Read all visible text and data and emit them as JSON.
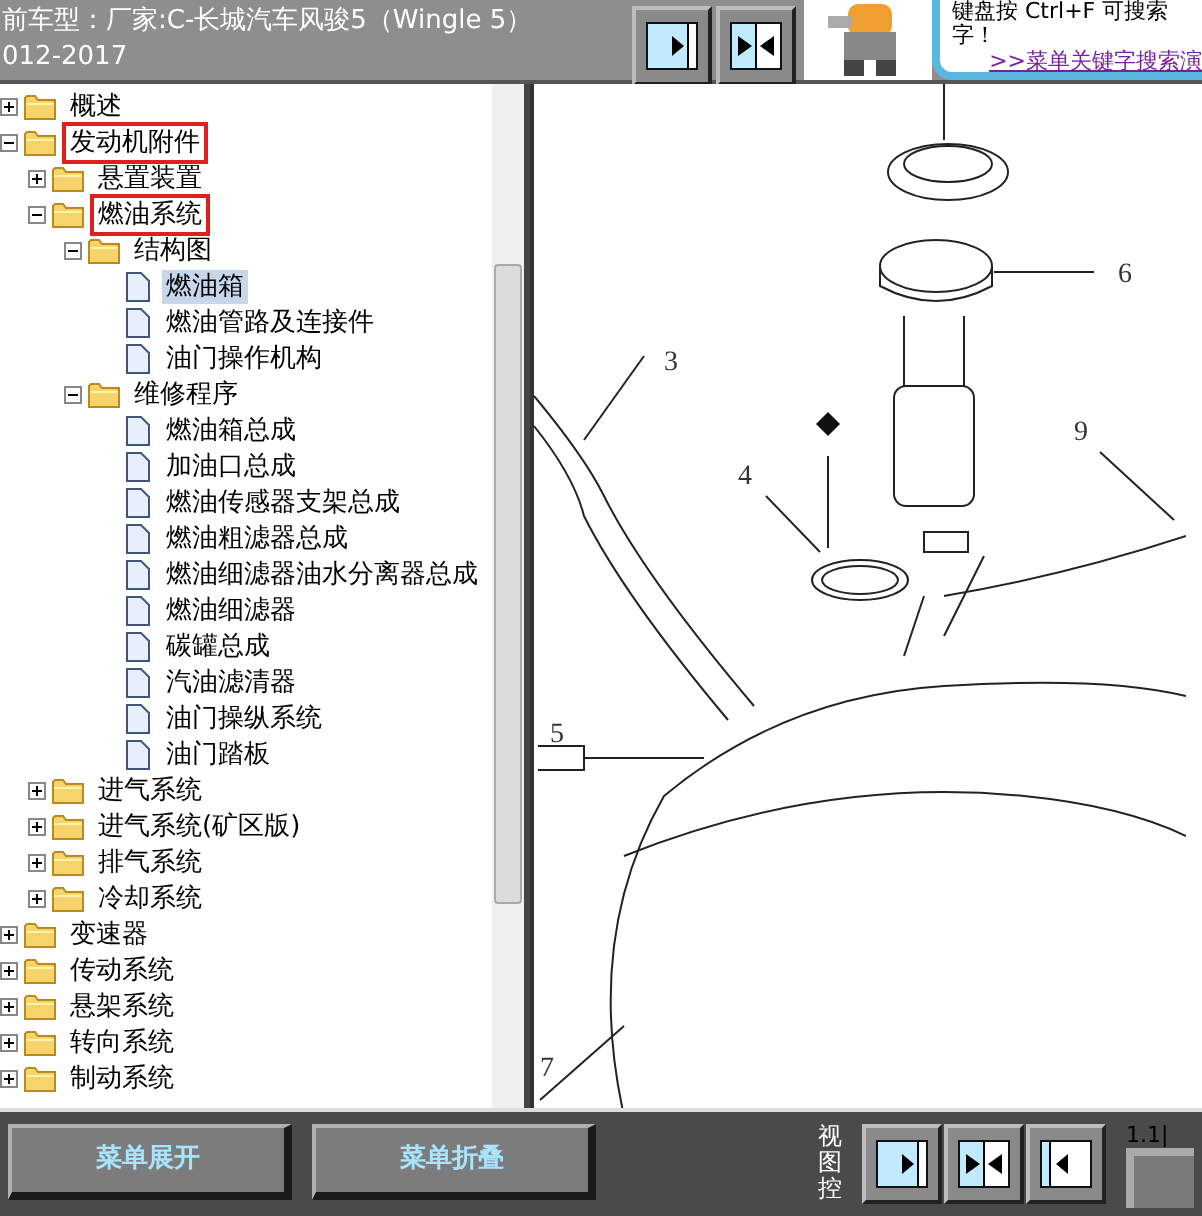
{
  "header": {
    "title_lines": [
      "前车型：厂家:C-长城汽车风骏5（Wingle 5）",
      "012-2017"
    ]
  },
  "tip": {
    "lines": [
      "键盘按 Ctrl+F 可搜索",
      "字！"
    ],
    "link": ">>菜单关键字搜索演"
  },
  "tree": [
    {
      "kind": "folder",
      "label": "概述",
      "expanded": false,
      "highlighted": false
    },
    {
      "kind": "folder",
      "label": "发动机附件",
      "expanded": true,
      "highlighted": true,
      "children": [
        {
          "kind": "folder",
          "label": "悬置装置",
          "expanded": false,
          "highlighted": false
        },
        {
          "kind": "folder",
          "label": "燃油系统",
          "expanded": true,
          "highlighted": true,
          "children": [
            {
              "kind": "folder",
              "label": "结构图",
              "expanded": true,
              "highlighted": false,
              "children": [
                {
                  "kind": "document",
                  "label": "燃油箱",
                  "selected": true
                },
                {
                  "kind": "document",
                  "label": "燃油管路及连接件",
                  "selected": false
                },
                {
                  "kind": "document",
                  "label": "油门操作机构",
                  "selected": false
                }
              ]
            },
            {
              "kind": "folder",
              "label": "维修程序",
              "expanded": true,
              "highlighted": false,
              "children": [
                {
                  "kind": "document",
                  "label": "燃油箱总成",
                  "selected": false
                },
                {
                  "kind": "document",
                  "label": "加油口总成",
                  "selected": false
                },
                {
                  "kind": "document",
                  "label": "燃油传感器支架总成",
                  "selected": false
                },
                {
                  "kind": "document",
                  "label": "燃油粗滤器总成",
                  "selected": false
                },
                {
                  "kind": "document",
                  "label": "燃油细滤器油水分离器总成",
                  "selected": false
                },
                {
                  "kind": "document",
                  "label": "燃油细滤器",
                  "selected": false
                },
                {
                  "kind": "document",
                  "label": "碳罐总成",
                  "selected": false
                },
                {
                  "kind": "document",
                  "label": "汽油滤清器",
                  "selected": false
                },
                {
                  "kind": "document",
                  "label": "油门操纵系统",
                  "selected": false
                },
                {
                  "kind": "document",
                  "label": "油门踏板",
                  "selected": false
                }
              ]
            }
          ]
        },
        {
          "kind": "folder",
          "label": "进气系统",
          "expanded": false,
          "highlighted": false
        },
        {
          "kind": "folder",
          "label": "进气系统(矿区版)",
          "expanded": false,
          "highlighted": false
        },
        {
          "kind": "folder",
          "label": "排气系统",
          "expanded": false,
          "highlighted": false
        },
        {
          "kind": "folder",
          "label": "冷却系统",
          "expanded": false,
          "highlighted": false
        }
      ]
    },
    {
      "kind": "folder",
      "label": "变速器",
      "expanded": false,
      "highlighted": false
    },
    {
      "kind": "folder",
      "label": "传动系统",
      "expanded": false,
      "highlighted": false
    },
    {
      "kind": "folder",
      "label": "悬架系统",
      "expanded": false,
      "highlighted": false
    },
    {
      "kind": "folder",
      "label": "转向系统",
      "expanded": false,
      "highlighted": false
    },
    {
      "kind": "folder",
      "label": "制动系统",
      "expanded": false,
      "highlighted": false
    }
  ],
  "diagram": {
    "callouts": [
      "3",
      "4",
      "6",
      "9",
      "5",
      "7"
    ]
  },
  "footer": {
    "buttons": [
      "菜单展开",
      "菜单折叠"
    ],
    "view_label": "视图控",
    "version": "1.1|"
  }
}
